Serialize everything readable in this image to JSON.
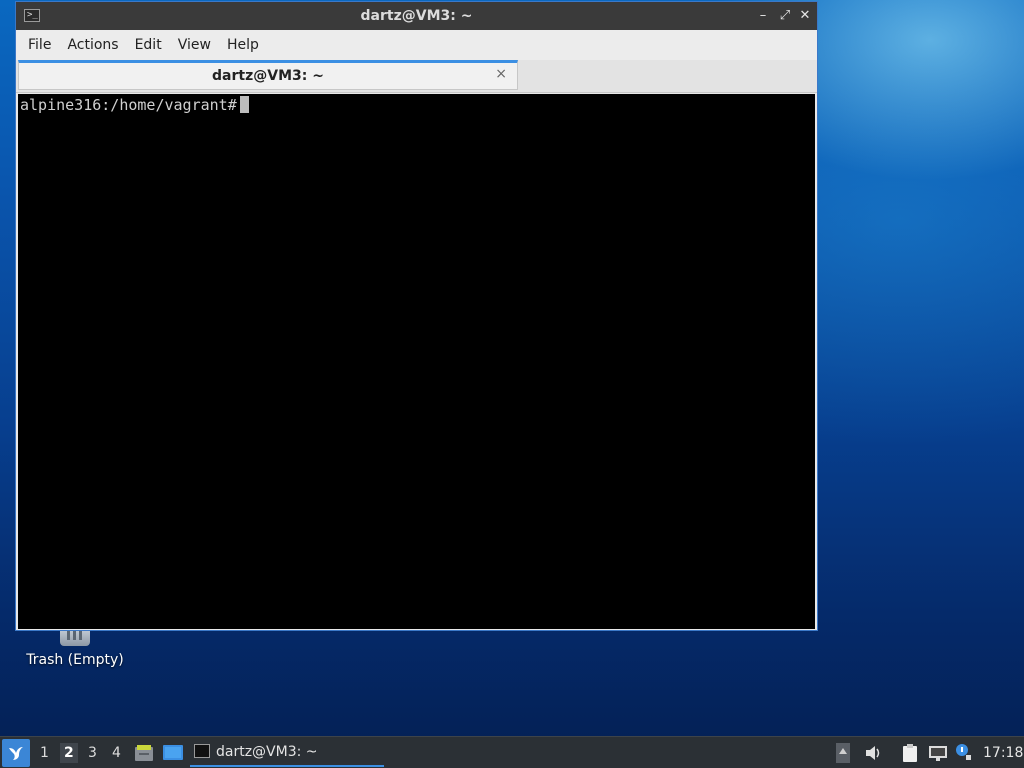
{
  "window": {
    "title": "dartz@VM3: ~",
    "controls": {
      "minimize": "–",
      "maximize": "⤢",
      "close": "✕"
    }
  },
  "menubar": {
    "items": [
      "File",
      "Actions",
      "Edit",
      "View",
      "Help"
    ]
  },
  "tabs": [
    {
      "label": "dartz@VM3: ~",
      "close": "×"
    }
  ],
  "console": {
    "prompt": "alpine316:/home/vagrant#"
  },
  "desktop": {
    "trash_label": "Trash (Empty)"
  },
  "taskbar": {
    "workspaces": [
      "1",
      "2",
      "3",
      "4"
    ],
    "active_workspace": "2",
    "task_label": "dartz@VM3: ~",
    "clock": "17:18",
    "accent": "#3b8fe3"
  }
}
